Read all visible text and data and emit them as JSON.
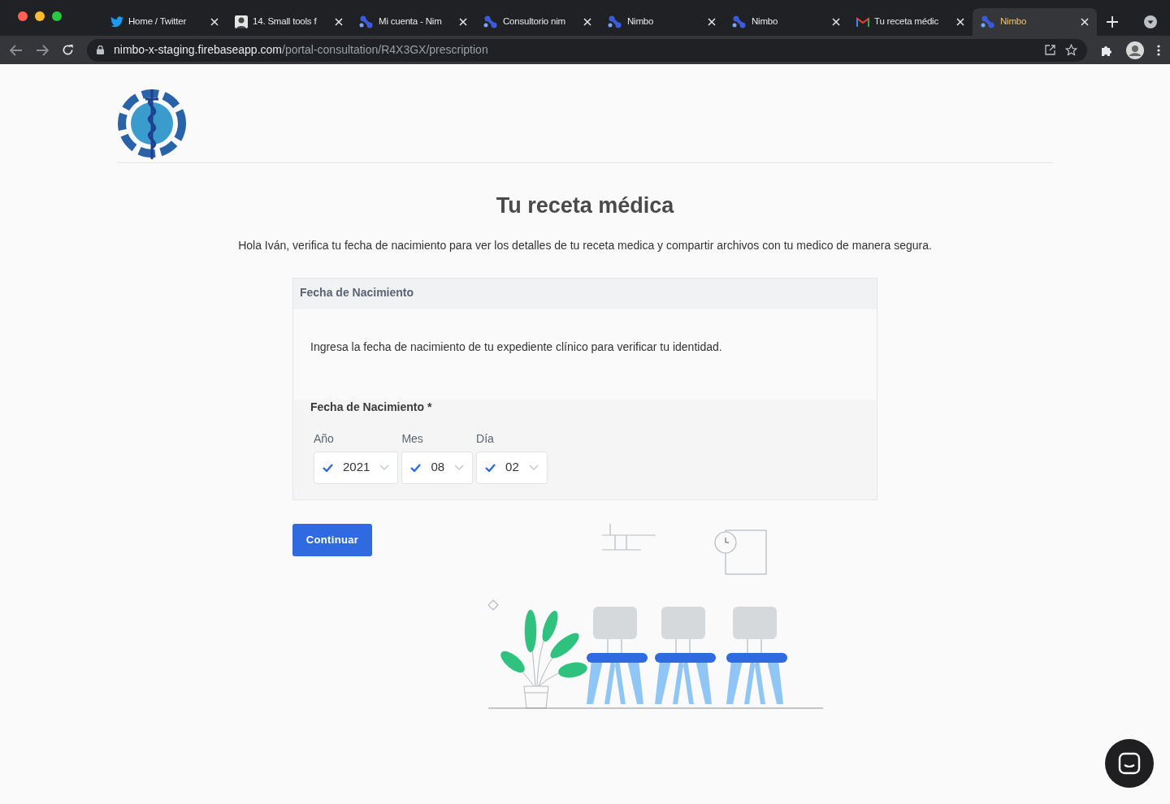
{
  "browser": {
    "tabs": [
      {
        "kind": "bird",
        "label": "Home / Twitter",
        "selected": false
      },
      {
        "kind": "portrait",
        "label": "14. Small tools f",
        "selected": false
      },
      {
        "kind": "dots",
        "label": "Mi cuenta - Nim",
        "selected": false
      },
      {
        "kind": "dots",
        "label": "Consultorio nim",
        "selected": false
      },
      {
        "kind": "dots",
        "label": "Nimbo",
        "selected": false
      },
      {
        "kind": "dots",
        "label": "Nimbo",
        "selected": false
      },
      {
        "kind": "mail",
        "label": "Tu receta médic",
        "selected": false
      },
      {
        "kind": "dots",
        "label": "Nimbo",
        "selected": true
      }
    ],
    "url": {
      "host": "nimbo-x-staging.firebaseapp.com",
      "path": "/portal-consultation/R4X3GX/prescription"
    }
  },
  "page": {
    "title": "Tu receta médica",
    "intro": "Hola Iván, verifica tu fecha de nacimiento para ver los detalles de tu receta medica y compartir archivos con tu medico de manera segura.",
    "card": {
      "header": "Fecha de Nacimiento",
      "description": "Ingresa la fecha de nacimiento de tu expediente clínico para verificar tu identidad.",
      "field_label": "Fecha de Nacimiento *",
      "selects": [
        {
          "label": "Año",
          "value": "2021",
          "valid": true
        },
        {
          "label": "Mes",
          "value": "08",
          "valid": true
        },
        {
          "label": "Día",
          "value": "02",
          "valid": true
        }
      ]
    },
    "button": "Continuar"
  }
}
